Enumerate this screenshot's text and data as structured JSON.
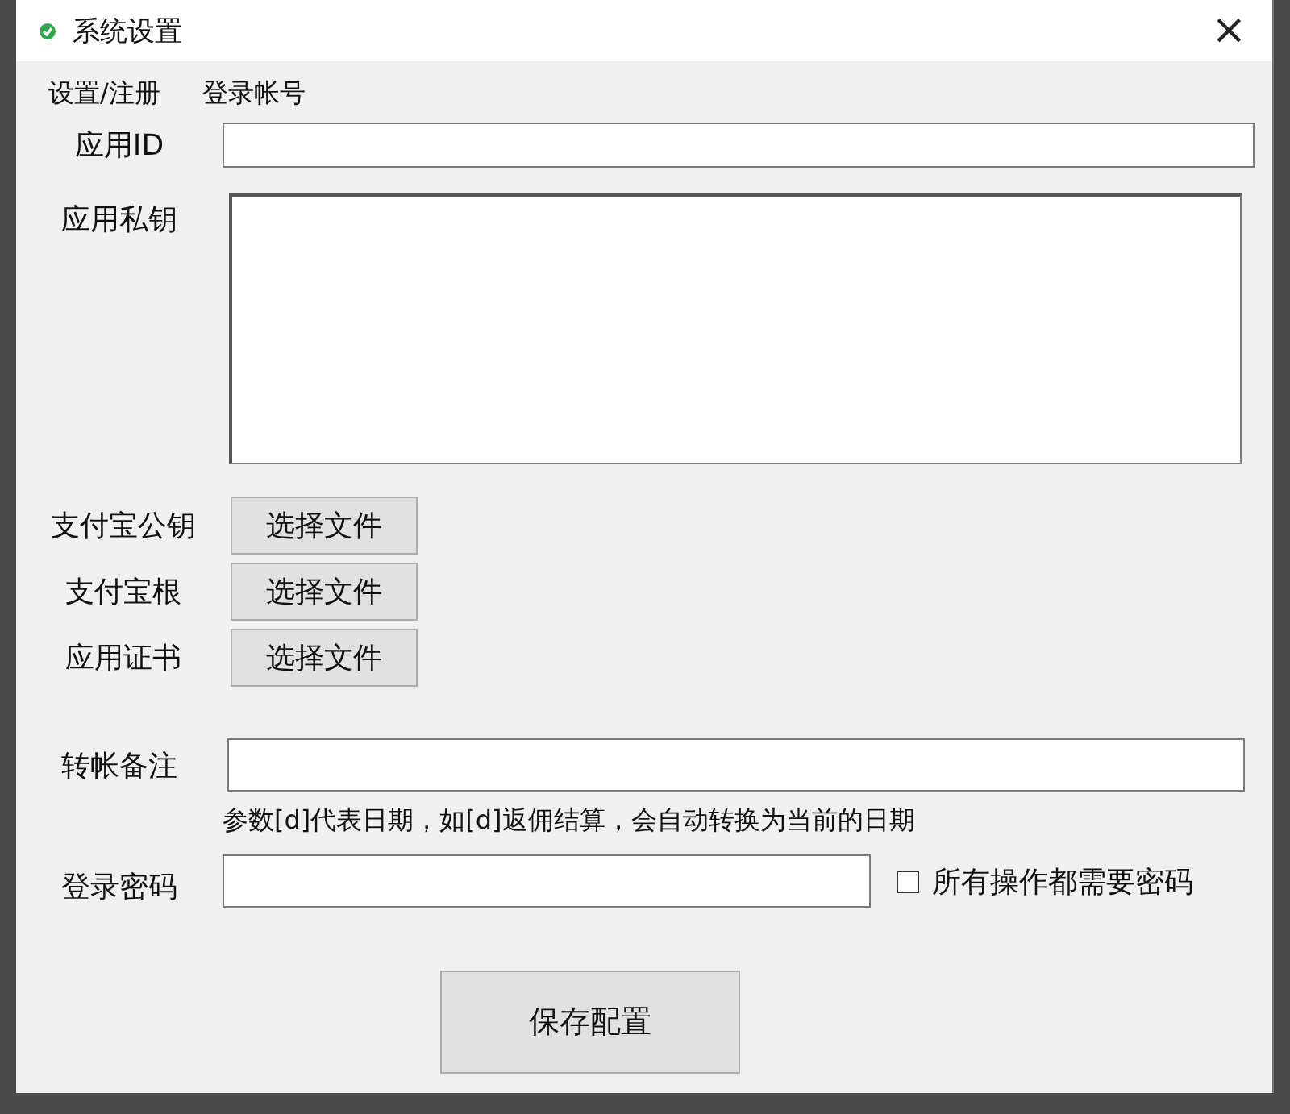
{
  "window": {
    "title": "系统设置",
    "close": "×"
  },
  "header_links": [
    "设置/注册",
    "登录帐号"
  ],
  "app_id": {
    "label": "应用ID"
  },
  "private_key": {
    "label": "应用私钥"
  },
  "file_rows": [
    {
      "label": "支付宝公钥",
      "button": "选择文件"
    },
    {
      "label": "支付宝根",
      "button": "选择文件"
    },
    {
      "label": "应用证书",
      "button": "选择文件"
    }
  ],
  "transfer_note": {
    "label": "转帐备注",
    "hint": "参数[d]代表日期，如[d]返佣结算，会自动转换为当前的日期"
  },
  "login_password": {
    "label": "登录密码",
    "checkbox": {
      "label": "所有操作都需要密码",
      "checked": false
    }
  },
  "save_button": "保存配置"
}
